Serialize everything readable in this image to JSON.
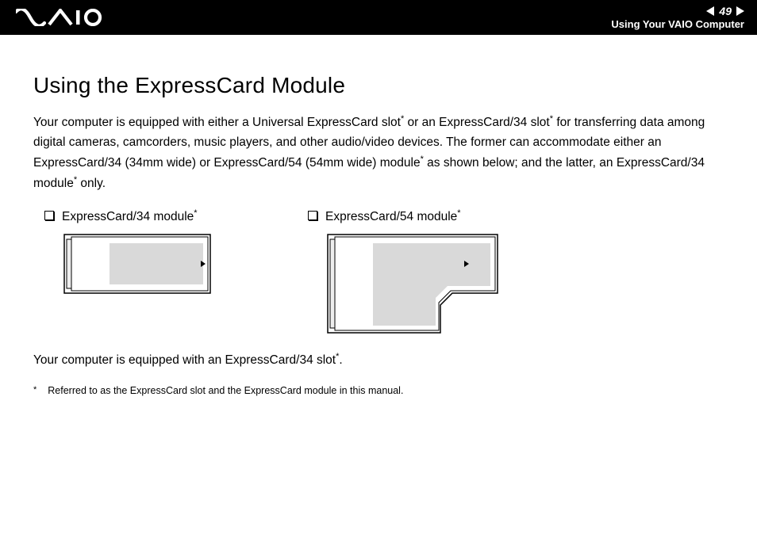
{
  "header": {
    "page_number": "49",
    "section_title": "Using Your VAIO Computer",
    "logo_label": "VAIO"
  },
  "title": "Using the ExpressCard Module",
  "paragraph1_parts": {
    "a": "Your computer is equipped with either a Universal ExpressCard slot",
    "b": " or an ExpressCard/34 slot",
    "c": " for transferring data among digital cameras, camcorders, music players, and other audio/video devices. The former can accommodate either an ExpressCard/34 (34mm wide) or ExpressCard/54 (54mm wide) module",
    "d": " as shown below; and the latter, an ExpressCard/34 module",
    "e": " only."
  },
  "cards": [
    {
      "label": "ExpressCard/34 module"
    },
    {
      "label": "ExpressCard/54 module"
    }
  ],
  "paragraph2_parts": {
    "a": "Your computer is equipped with an ExpressCard/34 slot",
    "b": "."
  },
  "footnote": {
    "mark": "*",
    "text": "Referred to as the ExpressCard slot and the ExpressCard module in this manual."
  },
  "asterisk": "*"
}
